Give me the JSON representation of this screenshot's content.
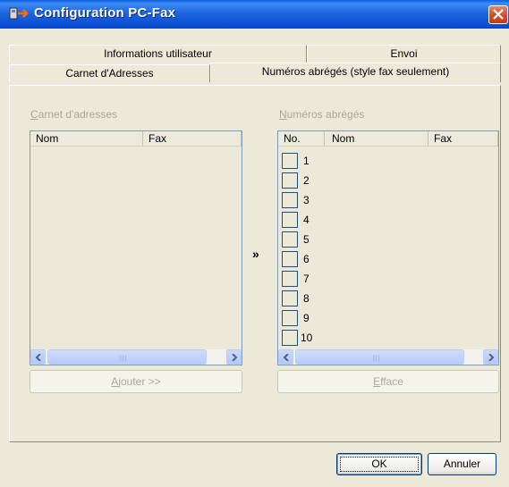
{
  "window": {
    "title": "Configuration PC-Fax",
    "icons": {
      "app": "pcfax-app-icon",
      "close": "close-icon"
    }
  },
  "tabs": {
    "row_back": [
      {
        "label": "Informations utilisateur"
      },
      {
        "label": "Envoi"
      }
    ],
    "row_front": [
      {
        "label": "Carnet d'Adresses"
      },
      {
        "label": "Numéros abrégés (style fax seulement)"
      }
    ]
  },
  "address_book": {
    "group_label_underlined": "C",
    "group_label_rest": "arnet d'adresses",
    "columns": [
      "Nom",
      "Fax"
    ]
  },
  "transfer_arrow": "»",
  "speed_dial": {
    "group_label_underlined": "N",
    "group_label_rest": "uméros abrégés",
    "columns": [
      "No.",
      "Nom",
      "Fax"
    ],
    "rows": [
      "1",
      "2",
      "3",
      "4",
      "5",
      "6",
      "7",
      "8",
      "9",
      "10"
    ]
  },
  "buttons": {
    "add_underlined": "A",
    "add_rest": "jouter >>",
    "clear_underlined": "E",
    "clear_rest": "fface",
    "ok": "OK",
    "cancel": "Annuler"
  }
}
